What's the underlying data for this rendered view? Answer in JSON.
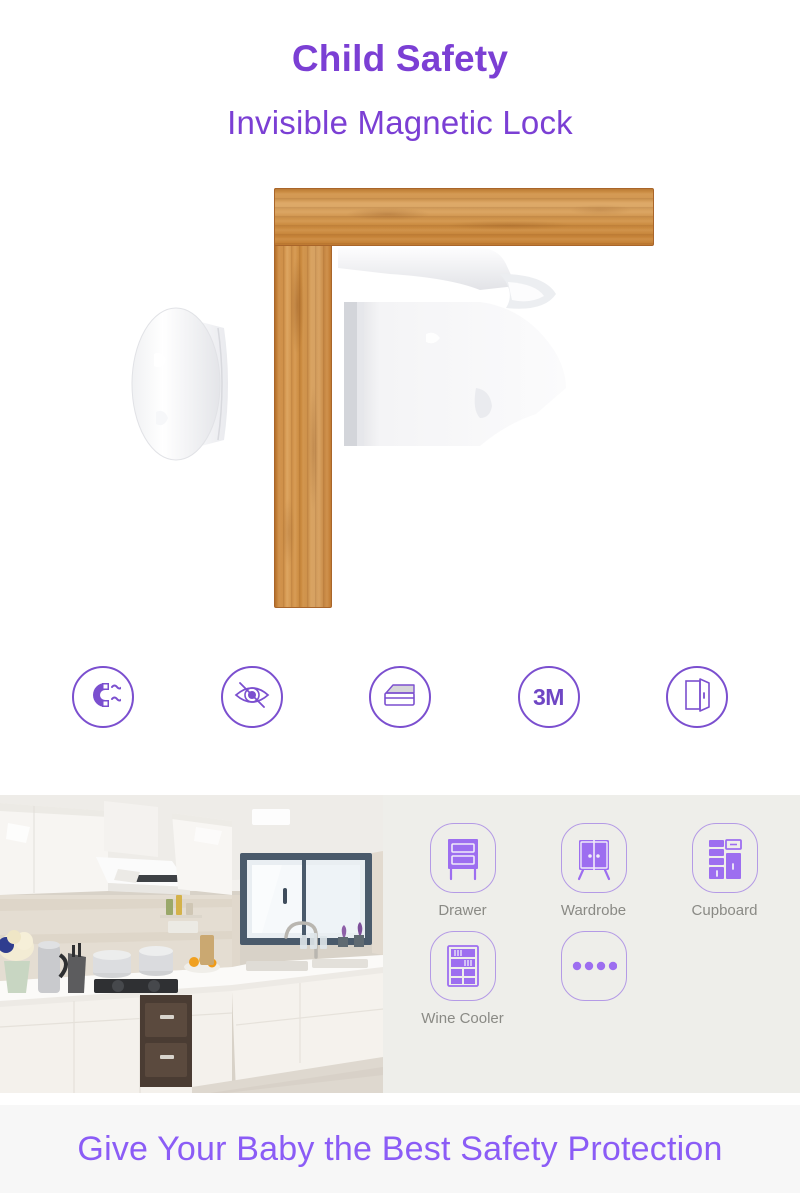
{
  "header": {
    "title_line1": "Child Safety",
    "title_line2": "Invisible Magnetic Lock",
    "accent_color": "#7b3fd4"
  },
  "hero": {
    "alt": "magnetic cabinet lock mounted inside wooden cabinet frame with round magnetic key",
    "wood_color": "#c9883c",
    "lock_color": "#f2f2f4",
    "parts": {
      "cabinet_frame": "wooden-cabinet-frame",
      "lock_mechanism": "white-lock-latch",
      "magnetic_key": "round-magnetic-key"
    }
  },
  "features": {
    "accent_color": "#7b4fcf",
    "items": [
      {
        "icon": "magnet-icon",
        "label": "magnetic"
      },
      {
        "icon": "eye-slash-icon",
        "label": "invisible"
      },
      {
        "icon": "drawer-icon",
        "label": "drawer"
      },
      {
        "icon": "3m-adhesive-icon",
        "label": "3M"
      },
      {
        "icon": "open-door-icon",
        "label": "door"
      }
    ],
    "adhesive_text": "3M"
  },
  "applications": {
    "background_color": "#eeeeea",
    "label_color": "#8a8a85",
    "icon_color": "#8c5cf0",
    "photo": {
      "alt": "modern white kitchen with range hood, window, sink and cabinets"
    },
    "items": [
      {
        "icon": "drawer-cabinet-icon",
        "label": "Drawer"
      },
      {
        "icon": "wardrobe-icon",
        "label": "Wardrobe"
      },
      {
        "icon": "cupboard-icon",
        "label": "Cupboard"
      },
      {
        "icon": "wine-cooler-icon",
        "label": "Wine Cooler"
      },
      {
        "icon": "more-dots-icon",
        "label": ""
      }
    ]
  },
  "footer": {
    "text": "Give Your Baby the Best Safety Protection",
    "accent_color": "#8b5cf6",
    "background_color": "#f7f7f7"
  }
}
